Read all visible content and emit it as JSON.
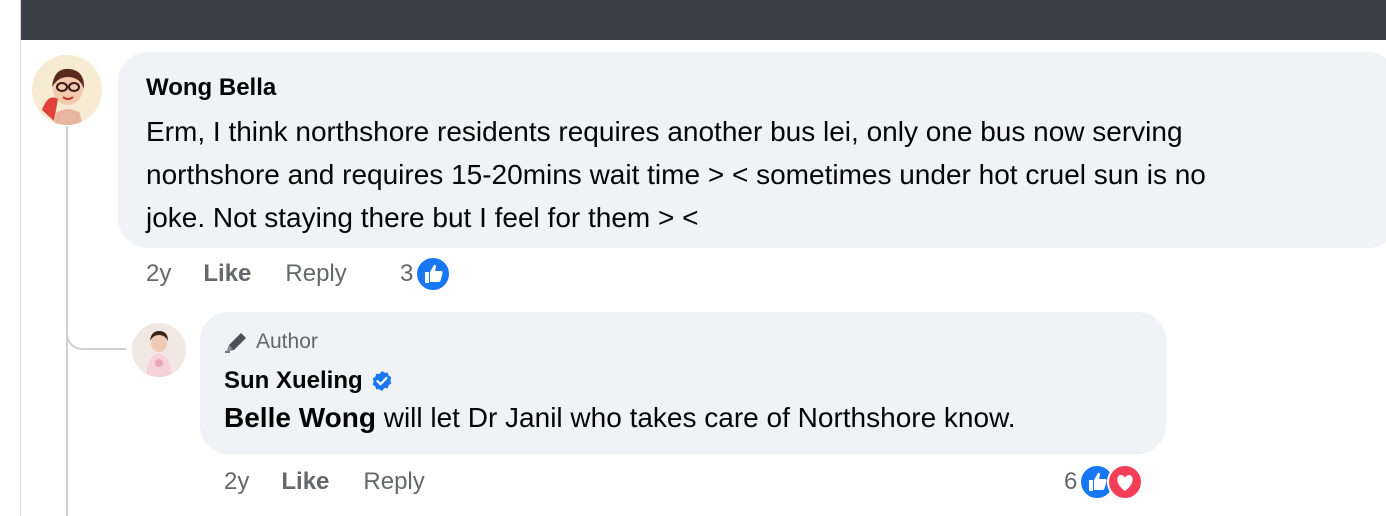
{
  "comment": {
    "author": "Wong Bella",
    "text": "Erm, I think northshore residents requires another bus lei, only one bus now serving\nnorthshore and requires 15-20mins wait time > < sometimes under hot cruel sun is no\njoke. Not staying there but I feel for them > <",
    "time": "2y",
    "like_label": "Like",
    "reply_label": "Reply",
    "reaction_count": "3",
    "reaction_icons": [
      "like-icon"
    ]
  },
  "reply": {
    "badge": "Author",
    "author": "Sun Xueling",
    "mention": "Belle Wong",
    "text": " will let Dr Janil who takes care of Northshore know.",
    "time": "2y",
    "like_label": "Like",
    "reply_label": "Reply",
    "reaction_count": "6",
    "reaction_icons": [
      "like-icon",
      "love-icon"
    ]
  },
  "colors": {
    "like_blue": "#1877f2",
    "love_red": "#f33e58",
    "bubble": "#f0f2f5",
    "topbar": "#3a3f49"
  }
}
